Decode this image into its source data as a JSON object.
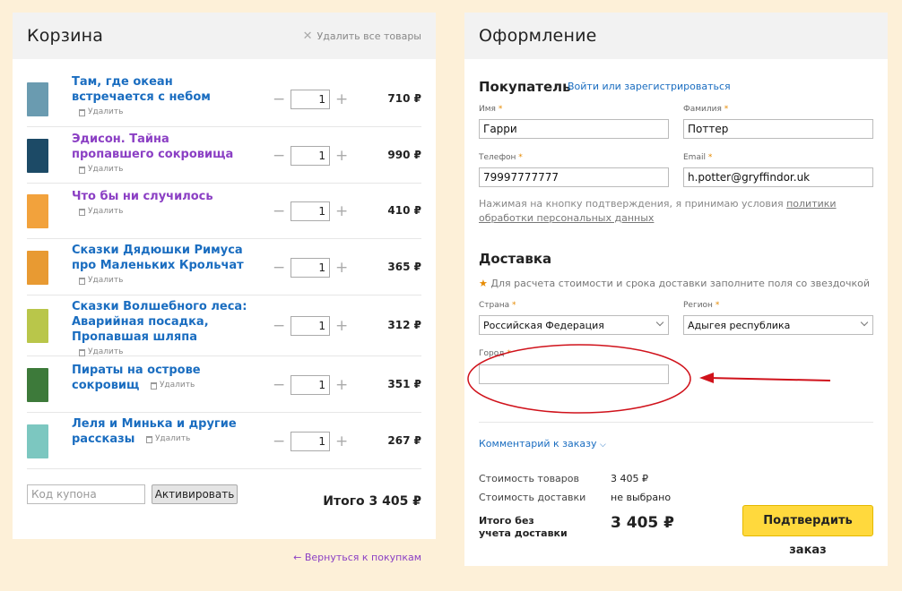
{
  "cart": {
    "title": "Корзина",
    "clear_all": "Удалить все товары",
    "delete_label": "Удалить",
    "items": [
      {
        "title": "Там, где океан встречается с небом",
        "qty": "1",
        "price": "710 ₽",
        "visited": false,
        "cover_color": "#6a9bb0"
      },
      {
        "title": "Эдисон. Тайна пропавшего сокровища",
        "qty": "1",
        "price": "990 ₽",
        "visited": true,
        "cover_color": "#1c4a66"
      },
      {
        "title": "Что бы ни случилось",
        "qty": "1",
        "price": "410 ₽",
        "visited": true,
        "cover_color": "#f2a23c"
      },
      {
        "title": "Сказки Дядюшки Римуса про Маленьких Крольчат",
        "qty": "1",
        "price": "365 ₽",
        "visited": false,
        "cover_color": "#e89a32"
      },
      {
        "title": "Сказки Волшебного леса: Аварийная посадка, Пропавшая шляпа",
        "qty": "1",
        "price": "312 ₽",
        "visited": false,
        "cover_color": "#b9c64a"
      },
      {
        "title": "Пираты на острове сокровищ",
        "qty": "1",
        "price": "351 ₽",
        "visited": false,
        "cover_color": "#3d7a3a"
      },
      {
        "title": "Леля и Минька и другие рассказы",
        "qty": "1",
        "price": "267 ₽",
        "visited": false,
        "cover_color": "#7cc7c0"
      }
    ],
    "coupon_placeholder": "Код купона",
    "activate_label": "Активировать",
    "total": "Итого 3 405 ₽",
    "back_link": "← Вернуться к покупкам"
  },
  "checkout": {
    "title": "Оформление",
    "buyer_title": "Покупатель",
    "login_link": "Войти или зарегистрироваться",
    "name_label": "Имя",
    "name_value": "Гарри",
    "surname_label": "Фамилия",
    "surname_value": "Поттер",
    "phone_label": "Телефон",
    "phone_value": "79997777777",
    "email_label": "Email",
    "email_value": "h.potter@gryffindor.uk",
    "consent_text": "Нажимая на кнопку подтверждения, я принимаю условия ",
    "consent_link": "политики обработки персональных данных",
    "delivery_title": "Доставка",
    "delivery_hint": "Для расчета стоимости и срока доставки заполните поля со звездочкой",
    "country_label": "Страна",
    "country_value": "Российская Федерация",
    "region_label": "Регион",
    "region_value": "Адыгея республика",
    "city_label": "Город",
    "city_value": "",
    "comment_link": "Комментарий к заказу",
    "goods_cost_label": "Стоимость товаров",
    "goods_cost_value": "3 405 ₽",
    "delivery_cost_label": "Стоимость доставки",
    "delivery_cost_value": "не выбрано",
    "grand_label": "Итого без учета доставки",
    "grand_value": "3 405 ₽",
    "confirm_label": "Подтвердить заказ"
  },
  "annotation": {
    "color": "#d0121b"
  }
}
